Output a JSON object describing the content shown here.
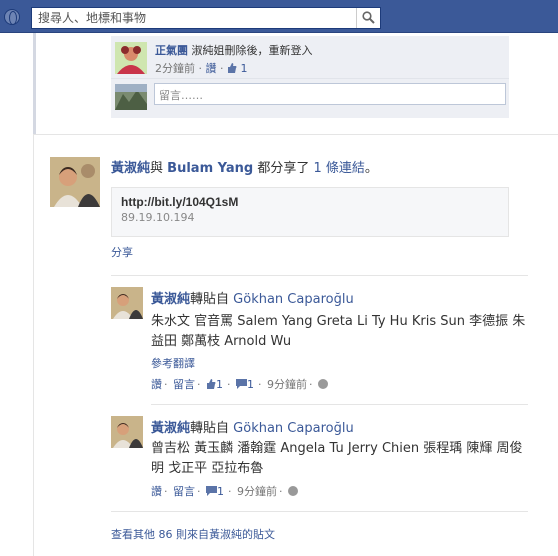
{
  "header": {
    "search_placeholder": "搜尋人、地標和事物"
  },
  "prev_comment": {
    "author": "正氣團",
    "text": "淑純姐刪除後，重新登入",
    "time": "2分鐘前",
    "like": "讚",
    "like_count": "1",
    "input_placeholder": "留言……"
  },
  "story": {
    "author": "黃淑純",
    "conj": "與",
    "with": "Bulam Yang",
    "verb": "都分享了",
    "count_link": "1 條連結",
    "end": "。",
    "url": "http://bit.ly/104Q1sM",
    "ip": "89.19.10.194",
    "share": "分享"
  },
  "reshares": [
    {
      "author": "黃淑純",
      "via": "轉貼自",
      "source": "Gökhan Caparoğlu",
      "text": "朱水文 官音罵 Salem Yang Greta Li Ty Hu Kris Sun 李德振 朱益田 鄭萬枝 Arnold Wu",
      "translate": "參考翻譯",
      "like": "讚",
      "comment": "留言",
      "like_count": "1",
      "comment_count": "1",
      "time": "9分鐘前"
    },
    {
      "author": "黃淑純",
      "via": "轉貼自",
      "source": "Gökhan Caparoğlu",
      "text": "曾吉松 黃玉麟 潘翰霆 Angela Tu Jerry Chien 張程瑀 陳輝 周俊明 戈正平 亞拉布魯",
      "like": "讚",
      "comment": "留言",
      "comment_count": "1",
      "time": "9分鐘前"
    }
  ],
  "more": "查看其他 86 則來自黃淑純的貼文",
  "separator": "·"
}
